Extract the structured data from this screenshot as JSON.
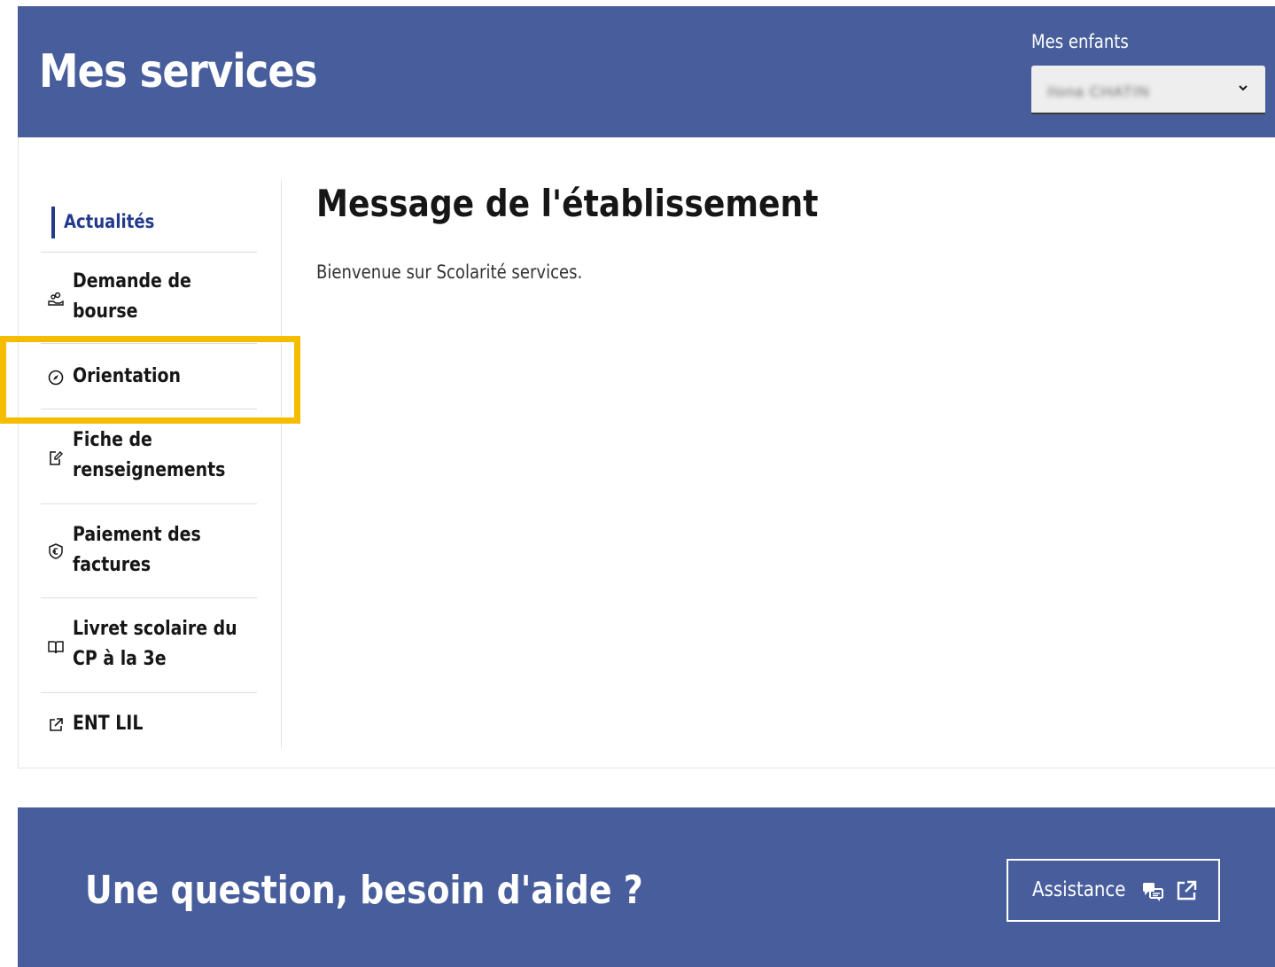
{
  "header": {
    "title": "Mes services",
    "children_label": "Mes enfants",
    "children_select_value": "Ilona CHATIN",
    "icon": "chevron-down-icon"
  },
  "sidenav": {
    "active": {
      "label": "Actualités"
    },
    "items": [
      {
        "label": "Demande de\nbourse",
        "icon": "hand-coins-icon"
      },
      {
        "label": "Orientation",
        "icon": "compass-icon"
      },
      {
        "label": "Fiche de\nrenseignements",
        "icon": "edit-document-icon"
      },
      {
        "label": "Paiement des\nfactures",
        "icon": "money-shield-icon"
      },
      {
        "label": "Livret scolaire du\nCP à la 3e",
        "icon": "book-icon"
      },
      {
        "label": "ENT LIL",
        "icon": "external-link-icon"
      }
    ]
  },
  "content": {
    "title": "Message de l'établissement",
    "message": "Bienvenue sur Scolarité services."
  },
  "footer": {
    "title": "Une question, besoin d'aide ?",
    "assist_label": "Assistance",
    "assist_icons": [
      "support-chat-icon",
      "external-link-icon"
    ]
  },
  "colors": {
    "brand_blue": "#485e9c",
    "active_blue": "#233a8b",
    "highlight": "#f5bc00"
  }
}
